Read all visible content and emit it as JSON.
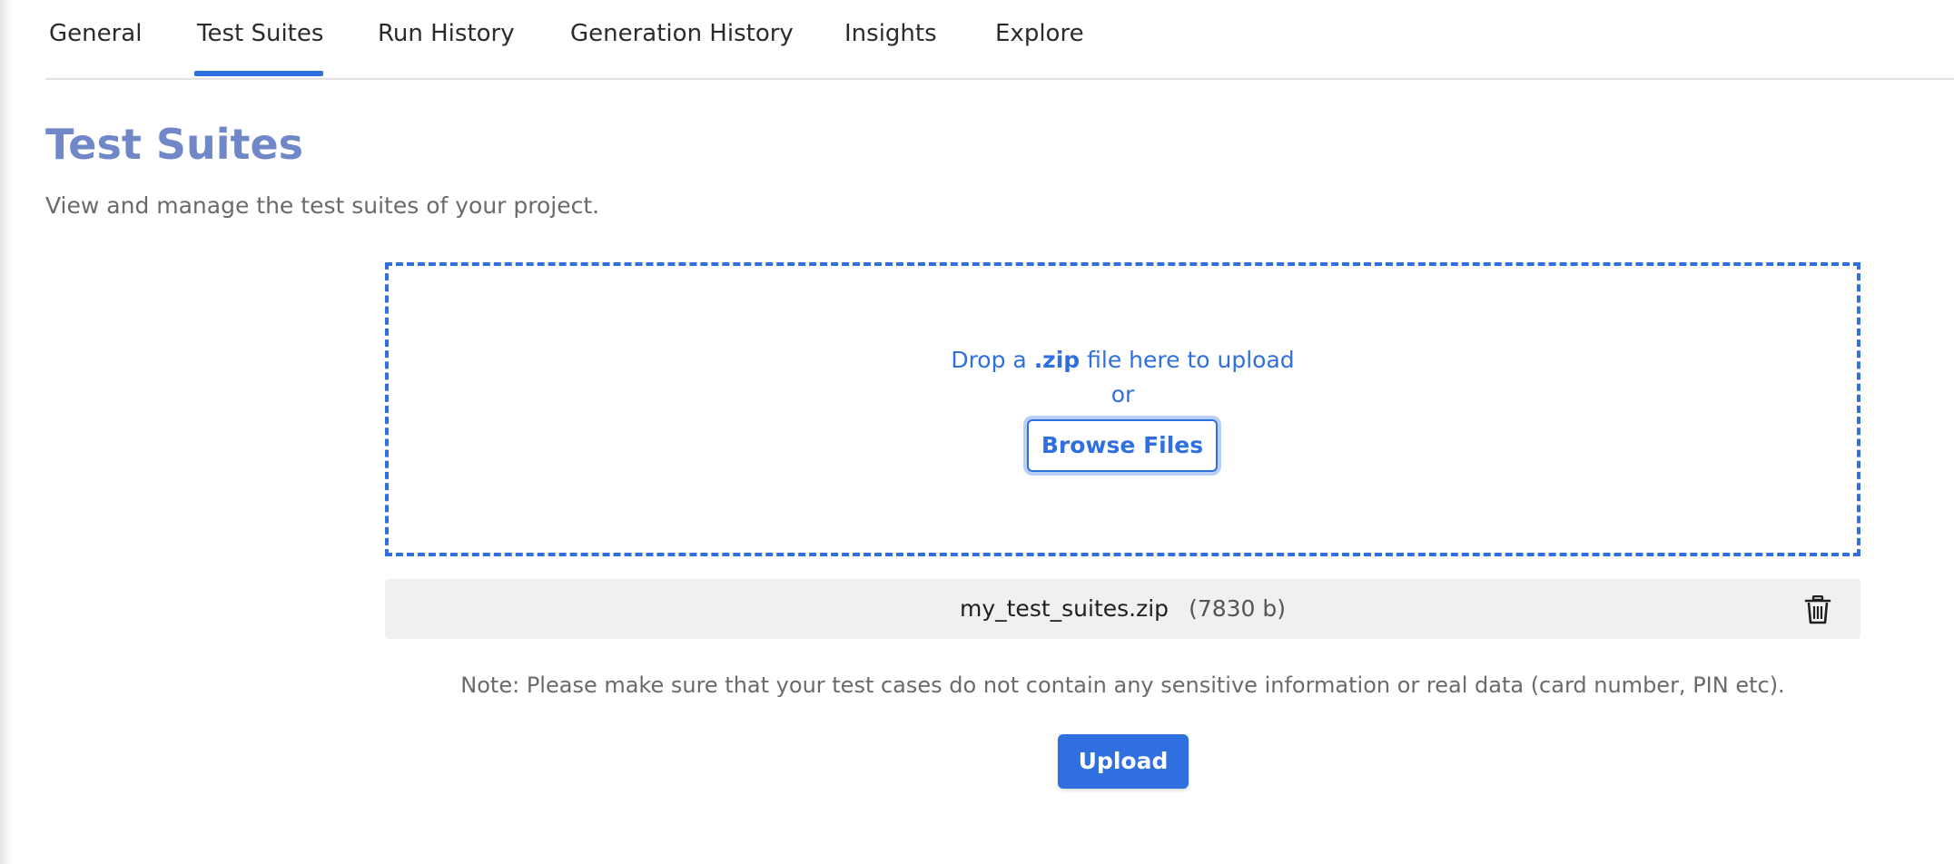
{
  "tabs": [
    {
      "label": "General"
    },
    {
      "label": "Test Suites",
      "active": true
    },
    {
      "label": "Run History"
    },
    {
      "label": "Generation History"
    },
    {
      "label": "Insights"
    },
    {
      "label": "Explore"
    }
  ],
  "page": {
    "title": "Test Suites",
    "subtitle": "View and manage the test suites of your project."
  },
  "dropzone": {
    "text_before": "Drop a ",
    "text_bold": ".zip",
    "text_after": " file here to upload",
    "or_text": "or",
    "browse_label": "Browse Files"
  },
  "file": {
    "name": "my_test_suites.zip",
    "size": "(7830 b)",
    "delete_icon": "trash-icon"
  },
  "note": "Note: Please make sure that your test cases do not contain any sensitive information or real data (card number, PIN etc).",
  "upload_label": "Upload",
  "colors": {
    "accent": "#2f6fe0",
    "title": "#7088c8"
  }
}
